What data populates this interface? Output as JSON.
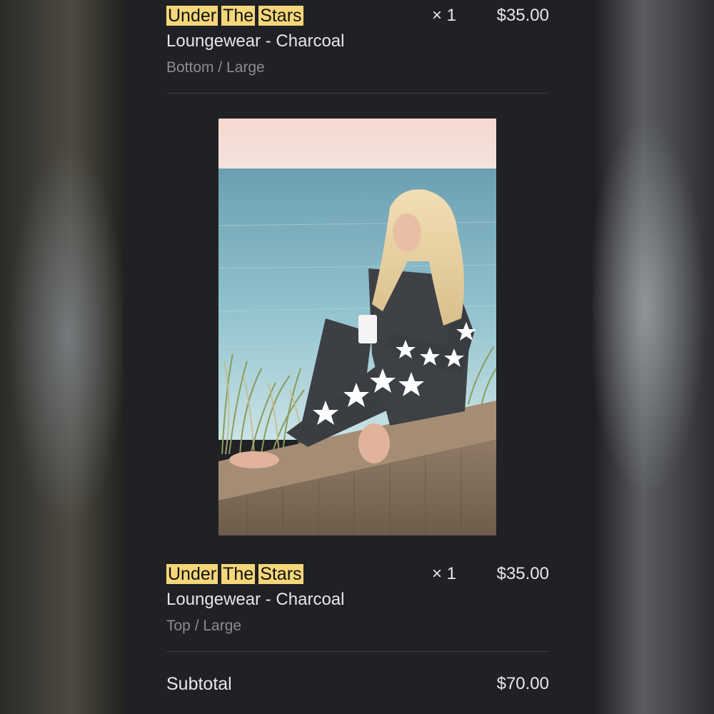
{
  "order_items": [
    {
      "brand_words": [
        "Under",
        "The",
        "Stars"
      ],
      "quantity": "× 1",
      "price": "$35.00",
      "product_name": "Loungewear - Charcoal",
      "variant": "Bottom / Large"
    },
    {
      "brand_words": [
        "Under",
        "The",
        "Stars"
      ],
      "quantity": "× 1",
      "price": "$35.00",
      "product_name": "Loungewear - Charcoal",
      "variant": "Top / Large"
    }
  ],
  "summary": {
    "subtotal_label": "Subtotal",
    "subtotal_value": "$70.00"
  },
  "colors": {
    "panel_background": "#202124",
    "highlight": "#f5d77a",
    "primary_text": "#e8e8e8",
    "secondary_text": "#8d8d90"
  },
  "icons": {
    "product_photo": "product-photo"
  }
}
